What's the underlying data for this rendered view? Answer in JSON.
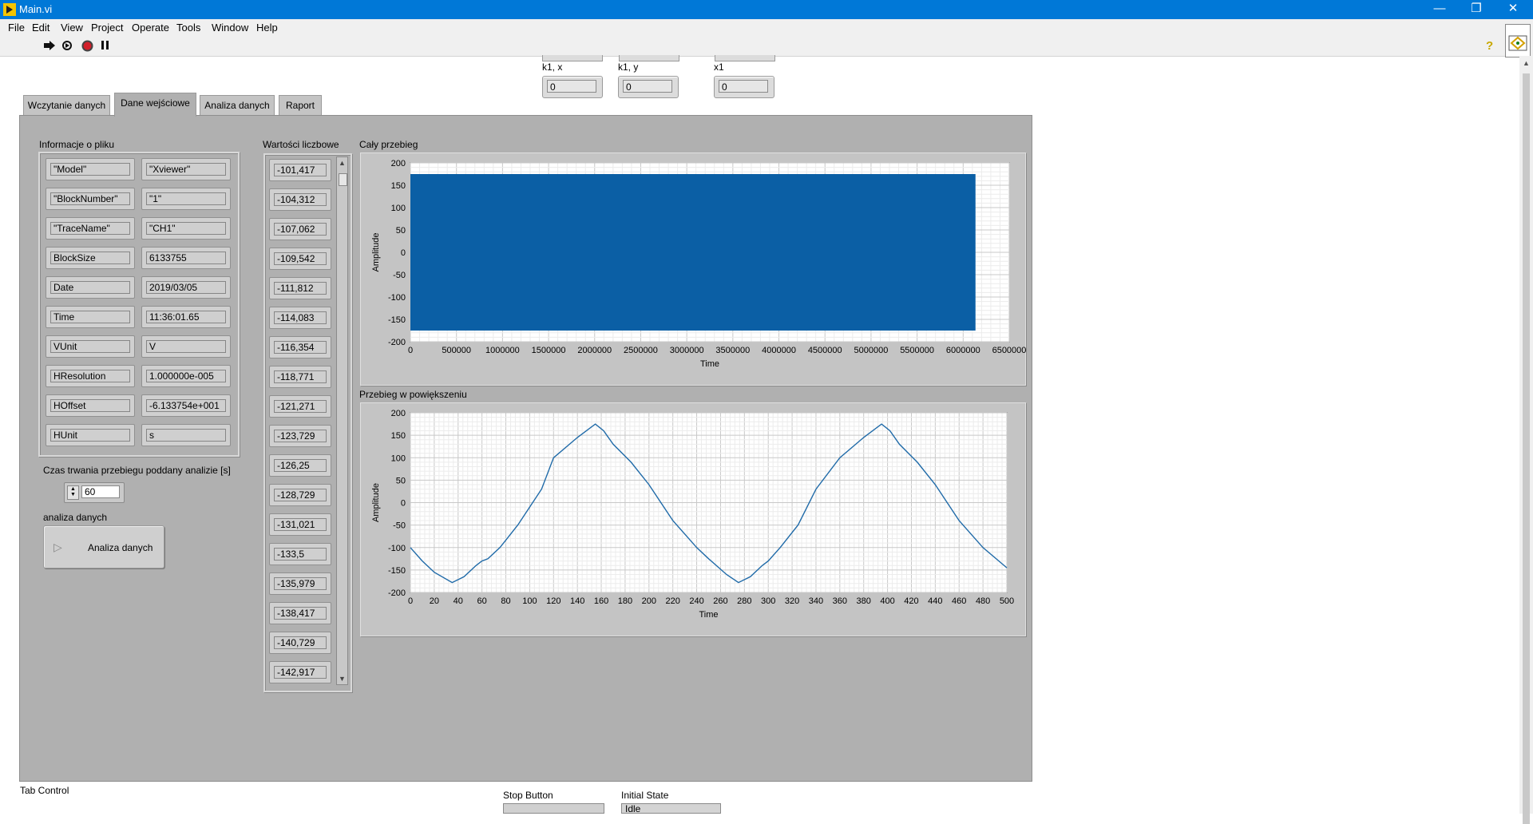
{
  "window": {
    "title": "Main.vi",
    "minimize": "—",
    "restore": "❐",
    "close": "✕"
  },
  "menu": [
    "File",
    "Edit",
    "View",
    "Project",
    "Operate",
    "Tools",
    "Window",
    "Help"
  ],
  "toolbar": {
    "help": "?"
  },
  "top_controls": [
    {
      "label": "k1, x",
      "value": "0"
    },
    {
      "label": "k1, y",
      "value": "0"
    },
    {
      "label": "x1",
      "value": "0"
    }
  ],
  "tabs": [
    "Wczytanie danych",
    "Dane wejściowe",
    "Analiza danych",
    "Raport"
  ],
  "active_tab": 1,
  "file_info": {
    "label": "Informacje o pliku",
    "rows": [
      [
        "\"Model\"",
        "\"Xviewer\""
      ],
      [
        "\"BlockNumber\"",
        "\"1\""
      ],
      [
        "\"TraceName\"",
        "\"CH1\""
      ],
      [
        "BlockSize",
        "6133755"
      ],
      [
        "Date",
        "2019/03/05"
      ],
      [
        "Time",
        "11:36:01.65"
      ],
      [
        "VUnit",
        "V"
      ],
      [
        "HResolution",
        "1.000000e-005"
      ],
      [
        "HOffset",
        "-6.133754e+001"
      ],
      [
        "HUnit",
        "s"
      ]
    ]
  },
  "values_list": {
    "label": "Wartości liczbowe",
    "values": [
      "-101,417",
      "-104,312",
      "-107,062",
      "-109,542",
      "-111,812",
      "-114,083",
      "-116,354",
      "-118,771",
      "-121,271",
      "-123,729",
      "-126,25",
      "-128,729",
      "-131,021",
      "-133,5",
      "-135,979",
      "-138,417",
      "-140,729",
      "-142,917"
    ]
  },
  "duration": {
    "label": "Czas trwania przebiegu poddany analizie [s]",
    "value": "60"
  },
  "analysis": {
    "label": "analiza danych",
    "button": "Analiza danych"
  },
  "bottom": {
    "tab_control_label": "Tab Control",
    "stop_label": "Stop Button",
    "initial_state_label": "Initial State",
    "initial_state_value": "Idle"
  },
  "chart_data": [
    {
      "type": "area",
      "title": "Cały przebieg",
      "xlabel": "Time",
      "ylabel": "Amplitude",
      "xlim": [
        0,
        6500000
      ],
      "ylim": [
        -200,
        200
      ],
      "x_ticks": [
        "0",
        "500000",
        "1000000",
        "1500000",
        "2000000",
        "2500000",
        "3000000",
        "3500000",
        "4000000",
        "4500000",
        "5000000",
        "5500000",
        "6000000",
        "6500000"
      ],
      "y_ticks": [
        "200",
        "150",
        "100",
        "50",
        "0",
        "-50",
        "-100",
        "-150",
        "-200"
      ],
      "series": [
        {
          "x_range": [
            0,
            6133755
          ],
          "y_range": [
            -175,
            175
          ]
        }
      ],
      "color": "#0b5fa5",
      "grid": true
    },
    {
      "type": "line",
      "title": "Przebieg w powiększeniu",
      "xlabel": "Time",
      "ylabel": "Amplitude",
      "xlim": [
        0,
        500
      ],
      "ylim": [
        -200,
        200
      ],
      "x_ticks": [
        "0",
        "20",
        "40",
        "60",
        "80",
        "100",
        "120",
        "140",
        "160",
        "180",
        "200",
        "220",
        "240",
        "260",
        "280",
        "300",
        "320",
        "340",
        "360",
        "380",
        "400",
        "420",
        "440",
        "460",
        "480",
        "500"
      ],
      "y_ticks": [
        "200",
        "150",
        "100",
        "50",
        "0",
        "-50",
        "-100",
        "-150",
        "-200"
      ],
      "x": [
        0,
        10,
        20,
        35,
        45,
        55,
        60,
        65,
        75,
        90,
        110,
        120,
        140,
        155,
        162,
        170,
        185,
        200,
        220,
        240,
        250,
        265,
        275,
        285,
        295,
        300,
        310,
        325,
        340,
        360,
        380,
        395,
        402,
        410,
        425,
        440,
        460,
        480,
        500
      ],
      "y": [
        -100,
        -130,
        -155,
        -178,
        -165,
        -140,
        -130,
        -125,
        -100,
        -50,
        30,
        100,
        145,
        175,
        160,
        130,
        90,
        40,
        -40,
        -100,
        -125,
        -160,
        -178,
        -165,
        -140,
        -130,
        -100,
        -50,
        30,
        100,
        145,
        175,
        160,
        130,
        90,
        40,
        -40,
        -100,
        -145
      ],
      "color": "#1f6aa8",
      "grid": true
    }
  ]
}
